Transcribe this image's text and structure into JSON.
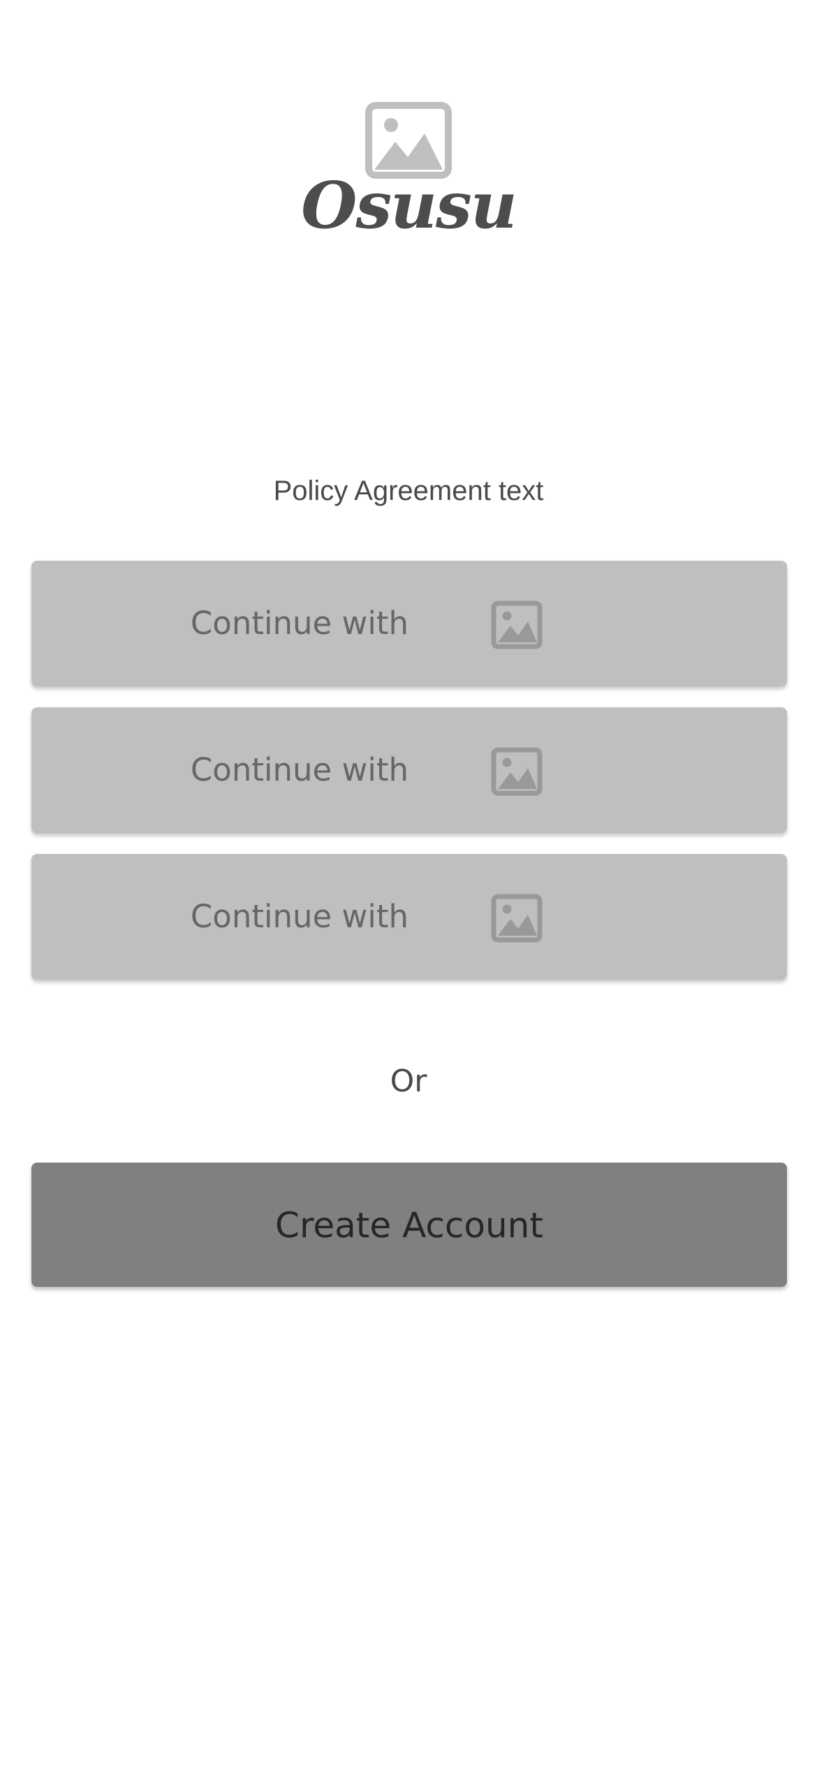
{
  "brand": {
    "name": "Osusu",
    "logo_icon": "image-placeholder-icon"
  },
  "policy": {
    "text": "Policy Agreement text"
  },
  "auth_buttons": [
    {
      "label": "Continue with",
      "icon": "image-placeholder-icon"
    },
    {
      "label": "Continue with",
      "icon": "image-placeholder-icon"
    },
    {
      "label": "Continue with",
      "icon": "image-placeholder-icon"
    }
  ],
  "divider": {
    "text": "Or"
  },
  "create_account": {
    "label": "Create Account"
  },
  "colors": {
    "background": "#ffffff",
    "auth_button_bg": "#bfbfbf",
    "auth_button_text": "#666666",
    "auth_icon": "#999999",
    "logo_icon": "#bfbfbf",
    "brand_text": "#4d4d4d",
    "create_button_bg": "#808080",
    "create_button_text": "#262626"
  }
}
